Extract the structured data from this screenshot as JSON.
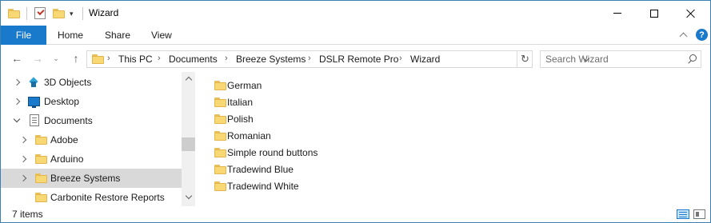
{
  "window": {
    "title": "Wizard"
  },
  "ribbon": {
    "tabs": [
      "File",
      "Home",
      "Share",
      "View"
    ],
    "help_glyph": "?"
  },
  "address": {
    "breadcrumbs": [
      "This PC",
      "Documents",
      "Breeze Systems",
      "DSLR Remote Pro",
      "Wizard"
    ]
  },
  "search": {
    "placeholder": "Search Wizard"
  },
  "nav_pane": {
    "items": [
      {
        "label": "3D Objects",
        "icon": "3d-objects-icon",
        "expand": "collapsed"
      },
      {
        "label": "Desktop",
        "icon": "desktop-icon",
        "expand": "collapsed"
      },
      {
        "label": "Documents",
        "icon": "documents-icon",
        "expand": "expanded"
      },
      {
        "label": "Adobe",
        "icon": "folder-icon",
        "expand": "collapsed"
      },
      {
        "label": "Arduino",
        "icon": "folder-icon",
        "expand": "collapsed"
      },
      {
        "label": "Breeze Systems",
        "icon": "folder-icon",
        "expand": "collapsed",
        "selected": true
      },
      {
        "label": "Carbonite Restore Reports",
        "icon": "folder-icon",
        "expand": "none"
      }
    ]
  },
  "content": {
    "items": [
      {
        "label": "German"
      },
      {
        "label": "Italian"
      },
      {
        "label": "Polish"
      },
      {
        "label": "Romanian"
      },
      {
        "label": "Simple round buttons"
      },
      {
        "label": "Tradewind Blue"
      },
      {
        "label": "Tradewind White"
      }
    ]
  },
  "status": {
    "item_count": "7 items"
  },
  "colors": {
    "accent": "#1979ca",
    "folder": "#f8d775",
    "selection": "#d9d9d9"
  }
}
